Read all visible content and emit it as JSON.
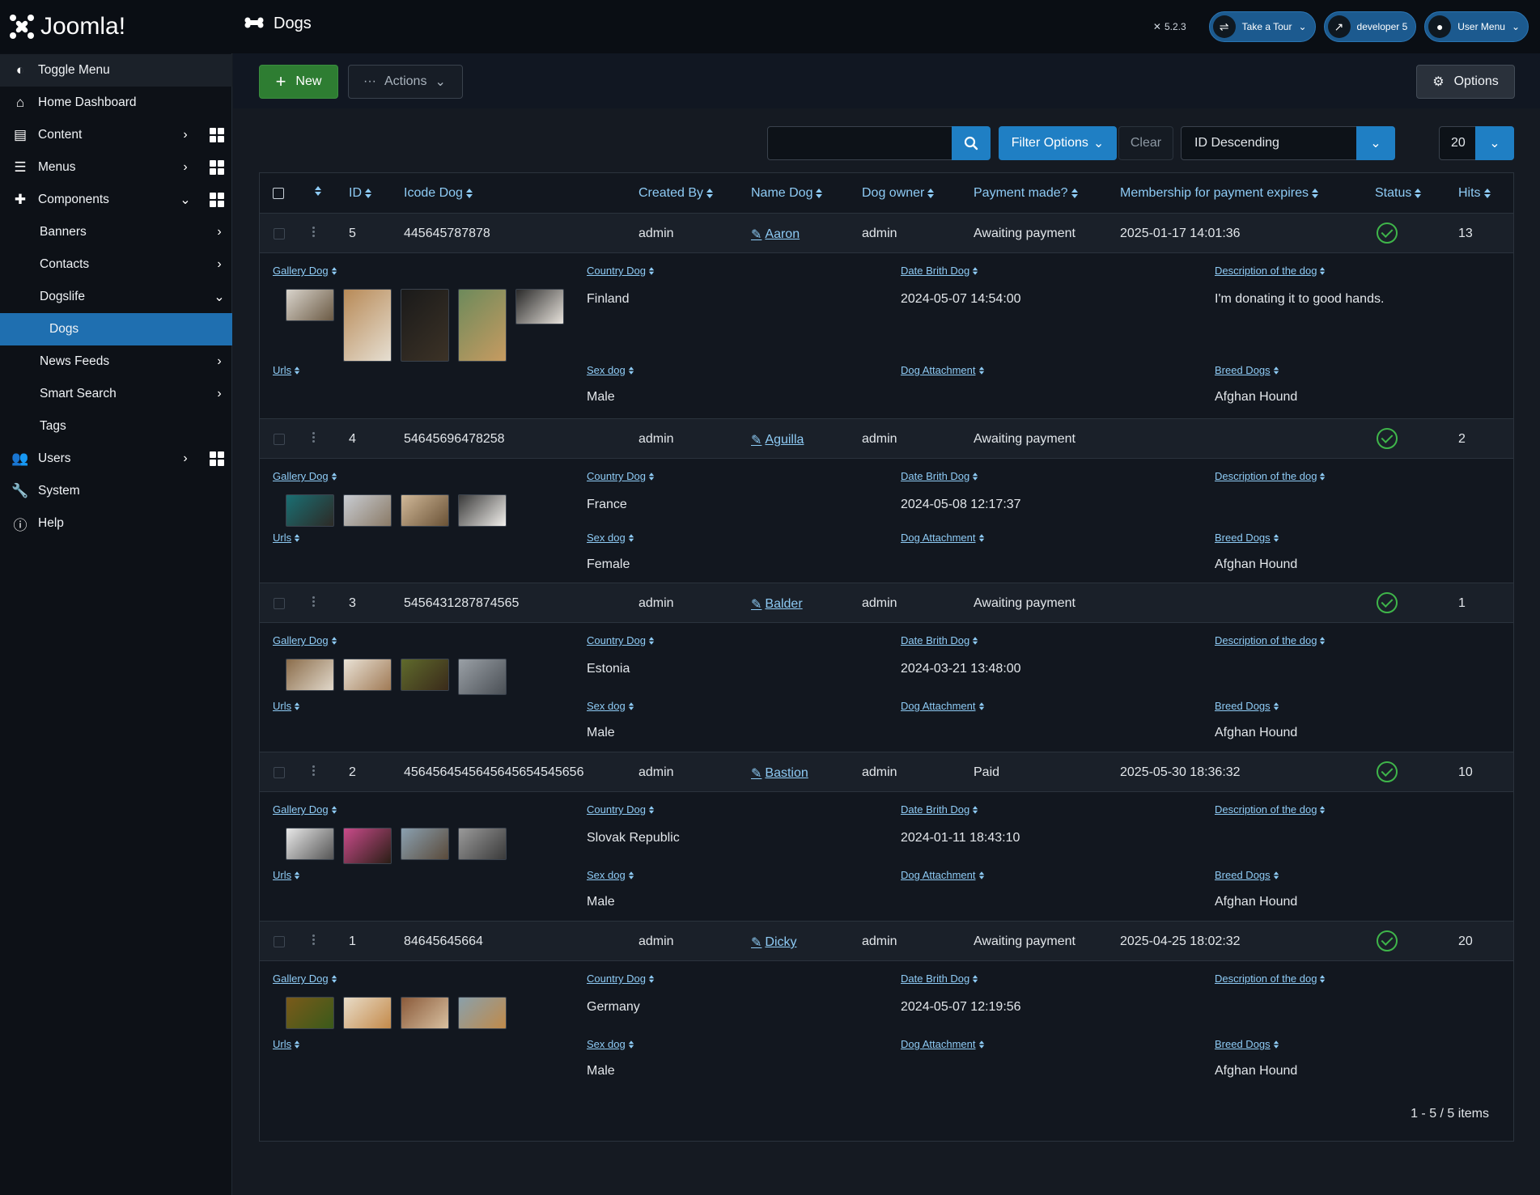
{
  "header": {
    "logo_text": "Joomla!",
    "page_title": "Dogs",
    "version": "5.2.3",
    "take_tour": "Take a Tour",
    "site_link": "developer 5",
    "user_menu": "User Menu"
  },
  "sidebar": {
    "toggle": "Toggle Menu",
    "home": "Home Dashboard",
    "content": "Content",
    "menus": "Menus",
    "components": "Components",
    "banners": "Banners",
    "contacts": "Contacts",
    "dogslife": "Dogslife",
    "dogs": "Dogs",
    "newsfeeds": "News Feeds",
    "smartsearch": "Smart Search",
    "tags": "Tags",
    "users": "Users",
    "system": "System",
    "help": "Help"
  },
  "toolbar": {
    "new": "New",
    "actions": "Actions",
    "options": "Options"
  },
  "filters": {
    "search_placeholder": "",
    "filter_options": "Filter Options",
    "clear": "Clear",
    "ordering": "ID Descending",
    "limit": "20"
  },
  "table": {
    "headers": {
      "id": "ID",
      "icode": "Icode Dog",
      "created_by": "Created By",
      "name": "Name Dog",
      "owner": "Dog owner",
      "payment": "Payment made?",
      "membership": "Membership for payment expires",
      "status": "Status",
      "hits": "Hits"
    },
    "detail_labels": {
      "gallery": "Gallery Dog",
      "country": "Country Dog",
      "birth": "Date Brith Dog",
      "description": "Description of the dog",
      "urls": "Urls",
      "sex": "Sex dog",
      "attachment": "Dog Attachment",
      "breed": "Breed Dogs"
    },
    "rows": [
      {
        "id": "5",
        "icode": "445645787878",
        "created_by": "admin",
        "name": "Aaron",
        "owner": "admin",
        "payment": "Awaiting payment",
        "expires": "2025-01-17 14:01:36",
        "hits": "13",
        "country": "Finland",
        "birth": "2024-05-07 14:54:00",
        "description": "I'm donating it to good hands.",
        "sex": "Male",
        "attachment": "",
        "breed": "Afghan Hound",
        "urls": ""
      },
      {
        "id": "4",
        "icode": "54645696478258",
        "created_by": "admin",
        "name": "Aguilla",
        "owner": "admin",
        "payment": "Awaiting payment",
        "expires": "",
        "hits": "2",
        "country": "France",
        "birth": "2024-05-08 12:17:37",
        "description": "",
        "sex": "Female",
        "attachment": "",
        "breed": "Afghan Hound",
        "urls": ""
      },
      {
        "id": "3",
        "icode": "5456431287874565",
        "created_by": "admin",
        "name": "Balder",
        "owner": "admin",
        "payment": "Awaiting payment",
        "expires": "",
        "hits": "1",
        "country": "Estonia",
        "birth": "2024-03-21 13:48:00",
        "description": "",
        "sex": "Male",
        "attachment": "",
        "breed": "Afghan Hound",
        "urls": ""
      },
      {
        "id": "2",
        "icode": "4564564545645645654545656",
        "created_by": "admin",
        "name": "Bastion",
        "owner": "admin",
        "payment": "Paid",
        "expires": "2025-05-30 18:36:32",
        "hits": "10",
        "country": "Slovak Republic",
        "birth": "2024-01-11 18:43:10",
        "description": "",
        "sex": "Male",
        "attachment": "",
        "breed": "Afghan Hound",
        "urls": ""
      },
      {
        "id": "1",
        "icode": "84645645664",
        "created_by": "admin",
        "name": "Dicky",
        "owner": "admin",
        "payment": "Awaiting payment",
        "expires": "2025-04-25 18:02:32",
        "hits": "20",
        "country": "Germany",
        "birth": "2024-05-07 12:19:56",
        "description": "",
        "sex": "Male",
        "attachment": "",
        "breed": "Afghan Hound",
        "urls": ""
      }
    ],
    "pagination": "1 - 5 / 5 items"
  },
  "colors": {
    "accent": "#1f7fc4",
    "success": "#2e7d32",
    "active": "#1f6fb0",
    "link": "#8ecbf5"
  }
}
